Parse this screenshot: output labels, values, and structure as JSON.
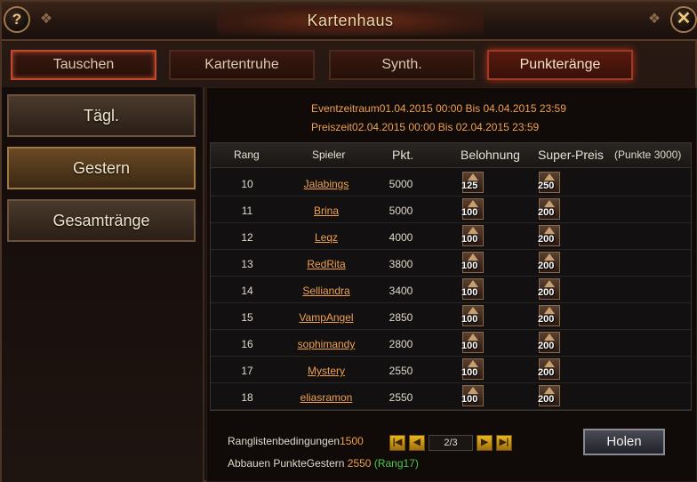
{
  "window": {
    "title": "Kartenhaus",
    "help_label": "?",
    "close_label": "✕"
  },
  "tabs": [
    {
      "label": "Tauschen"
    },
    {
      "label": "Kartentruhe"
    },
    {
      "label": "Synth."
    },
    {
      "label": "Punkteränge"
    }
  ],
  "sidebar": {
    "items": [
      {
        "label": "Tägl."
      },
      {
        "label": "Gestern"
      },
      {
        "label": "Gesamtränge"
      }
    ]
  },
  "event": {
    "period": "Eventzeitraum01.04.2015 00:00 Bis 04.04.2015 23:59",
    "prize": "Preiszeit02.04.2015 00:00 Bis 02.04.2015 23:59"
  },
  "table": {
    "headers": {
      "rank": "Rang",
      "player": "Spieler",
      "points": "Pkt.",
      "reward": "Belohnung",
      "super": "Super-Preis",
      "note": "(Punkte 3000)"
    },
    "rows": [
      {
        "rank": "10",
        "player": "Jalabings",
        "points": "5000",
        "reward": "125",
        "super": "250"
      },
      {
        "rank": "11",
        "player": "Brina",
        "points": "5000",
        "reward": "100",
        "super": "200"
      },
      {
        "rank": "12",
        "player": "Leqz",
        "points": "4000",
        "reward": "100",
        "super": "200"
      },
      {
        "rank": "13",
        "player": "RedRita",
        "points": "3800",
        "reward": "100",
        "super": "200"
      },
      {
        "rank": "14",
        "player": "Selliandra",
        "points": "3400",
        "reward": "100",
        "super": "200"
      },
      {
        "rank": "15",
        "player": "VampAngel",
        "points": "2850",
        "reward": "100",
        "super": "200"
      },
      {
        "rank": "16",
        "player": "sophimandy",
        "points": "2800",
        "reward": "100",
        "super": "200"
      },
      {
        "rank": "17",
        "player": "Mystery",
        "points": "2550",
        "reward": "100",
        "super": "200"
      },
      {
        "rank": "18",
        "player": "eliasramon",
        "points": "2550",
        "reward": "100",
        "super": "200"
      }
    ]
  },
  "footer": {
    "conditions_label": "Ranglistenbedingungen",
    "conditions_value": "1500",
    "mine_label": "Abbauen PunkteGestern",
    "mine_value": "2550",
    "mine_rank": "(Rang17)",
    "page": "2/3",
    "claim_label": "Holen"
  },
  "colors": {
    "accent": "#f0a050",
    "rank_green": "#4ec84a",
    "active_tab": "#a03a24"
  }
}
